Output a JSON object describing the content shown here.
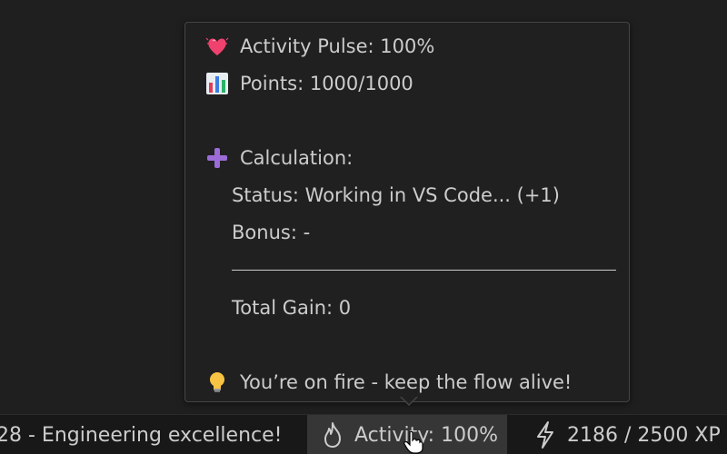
{
  "tooltip": {
    "pulse": "Activity Pulse: 100%",
    "points": "Points: 1000/1000",
    "calc_title": "Calculation:",
    "status": "Status: Working in VS Code... (+1)",
    "bonus": "Bonus: -",
    "total": "Total Gain: 0",
    "tip": "You’re on fire - keep the flow alive!"
  },
  "statusbar": {
    "left_text": "28 - Engineering excellence!",
    "activity_text": "Activity: 100%",
    "xp_text": "2186 / 2500 XP"
  },
  "icons": {
    "pulse": "beating-heart-icon",
    "points": "bar-chart-icon",
    "calc": "plus-icon",
    "tip": "light-bulb-icon",
    "activity": "flame-icon",
    "xp": "lightning-icon"
  }
}
